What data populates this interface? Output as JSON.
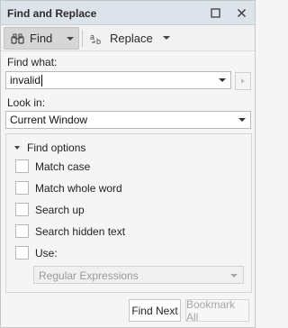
{
  "window": {
    "title": "Find and Replace",
    "restore_icon": "restore-icon",
    "close_icon": "close-icon"
  },
  "toolbar": {
    "find_label": "Find",
    "replace_label": "Replace",
    "find_icon": "binoculars-icon",
    "replace_icon": "replace-ab-icon"
  },
  "find_what": {
    "label": "Find what:",
    "value": "invalid"
  },
  "look_in": {
    "label": "Look in:",
    "value": "Current Window"
  },
  "options": {
    "header": "Find options",
    "items": [
      {
        "label": "Match case",
        "checked": false
      },
      {
        "label": "Match whole word",
        "checked": false
      },
      {
        "label": "Search up",
        "checked": false
      },
      {
        "label": "Search hidden text",
        "checked": false
      },
      {
        "label": "Use:",
        "checked": false
      }
    ],
    "use_select_value": "Regular Expressions"
  },
  "buttons": {
    "find_next": "Find Next",
    "bookmark_all": "Bookmark All"
  }
}
